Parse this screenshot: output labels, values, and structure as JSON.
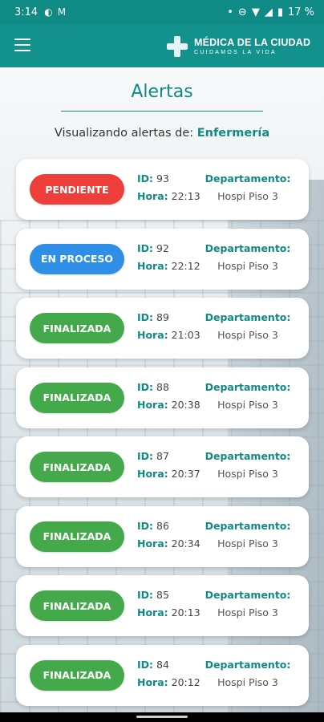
{
  "status_bar": {
    "time": "3:14",
    "battery": "17 %",
    "icons": [
      "app-icon",
      "gmail-icon",
      "dot-icon",
      "dnd-icon",
      "wifi-icon",
      "signal-icon",
      "battery-icon"
    ]
  },
  "app_bar": {
    "brand_name": "MÉDICA DE LA CIUDAD",
    "brand_tagline": "CUIDAMOS LA VIDA"
  },
  "header": {
    "title": "Alertas",
    "subtitle_prefix": "Visualizando alertas de: ",
    "department": "Enfermería"
  },
  "labels": {
    "id": "ID:",
    "hour": "Hora:",
    "department": "Departamento:"
  },
  "colors": {
    "teal": "#128a84",
    "pending": "#ee3e3a",
    "in_progress": "#2f8ee6",
    "finished": "#43a94a"
  },
  "alerts": [
    {
      "status": "PENDIENTE",
      "status_key": "pending",
      "id": "93",
      "hour": "22:13",
      "department": "Hospi Piso 3"
    },
    {
      "status": "EN PROCESO",
      "status_key": "in_progress",
      "id": "92",
      "hour": "22:12",
      "department": "Hospi Piso 3"
    },
    {
      "status": "FINALIZADA",
      "status_key": "finished",
      "id": "89",
      "hour": "21:03",
      "department": "Hospi Piso 3"
    },
    {
      "status": "FINALIZADA",
      "status_key": "finished",
      "id": "88",
      "hour": "20:38",
      "department": "Hospi Piso 3"
    },
    {
      "status": "FINALIZADA",
      "status_key": "finished",
      "id": "87",
      "hour": "20:37",
      "department": "Hospi Piso 3"
    },
    {
      "status": "FINALIZADA",
      "status_key": "finished",
      "id": "86",
      "hour": "20:34",
      "department": "Hospi Piso 3"
    },
    {
      "status": "FINALIZADA",
      "status_key": "finished",
      "id": "85",
      "hour": "20:13",
      "department": "Hospi Piso 3"
    },
    {
      "status": "FINALIZADA",
      "status_key": "finished",
      "id": "84",
      "hour": "20:12",
      "department": "Hospi Piso 3"
    }
  ]
}
